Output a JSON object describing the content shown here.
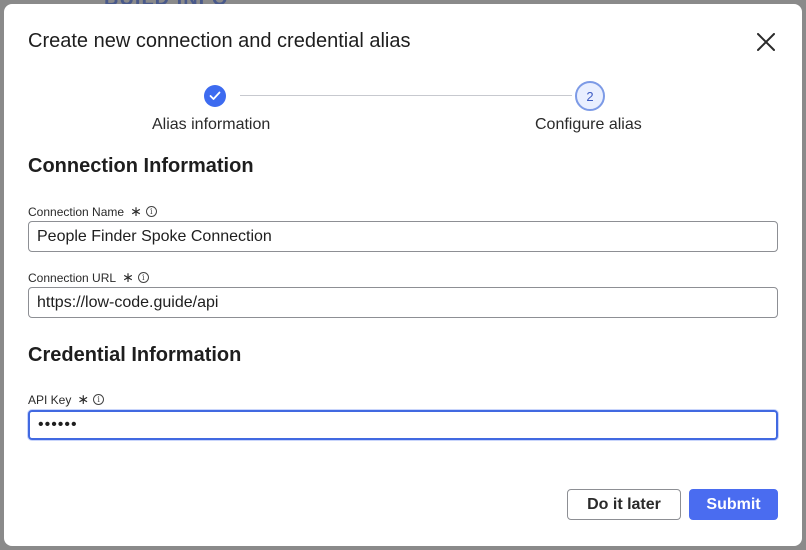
{
  "backdrop": {
    "partial_text": "BUILD INFO"
  },
  "modal": {
    "title": "Create new connection and credential alias",
    "close_icon": "close-icon"
  },
  "stepper": {
    "steps": [
      {
        "label": "Alias information",
        "status": "completed",
        "icon": "check-icon"
      },
      {
        "label": "Configure alias",
        "status": "current",
        "number": "2"
      }
    ]
  },
  "connection_section": {
    "heading": "Connection Information",
    "fields": [
      {
        "label": "Connection Name",
        "required": "∗",
        "value": "People Finder Spoke Connection"
      },
      {
        "label": "Connection URL",
        "required": "∗",
        "value": "https://low-code.guide/api"
      }
    ]
  },
  "credential_section": {
    "heading": "Credential Information",
    "fields": [
      {
        "label": "API Key",
        "required": "∗",
        "value": "••••••"
      }
    ]
  },
  "footer": {
    "later_label": "Do it later",
    "submit_label": "Submit"
  },
  "colors": {
    "primary": "#4a6cf0",
    "step_complete": "#3d6bf0",
    "focus_border": "#4169e1"
  }
}
